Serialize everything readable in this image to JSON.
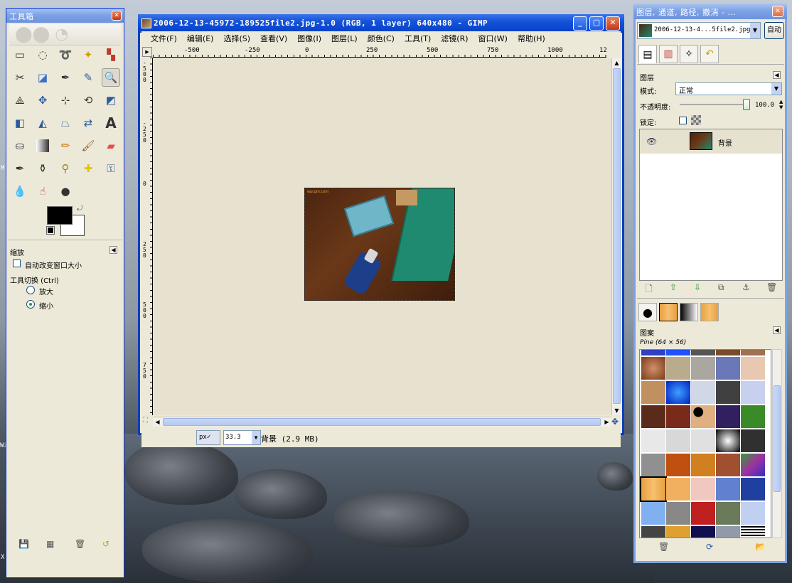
{
  "desktop_edge_texts": [
    "M",
    "Wi",
    "X"
  ],
  "toolbox": {
    "title": "工具箱",
    "close": "✕",
    "zoom_section": {
      "heading": "缩放",
      "auto_resize_label": "自动改变窗口大小",
      "switch_label": "工具切换 (Ctrl)",
      "zoom_in_label": "放大",
      "zoom_out_label": "缩小"
    }
  },
  "image_window": {
    "title": "2006-12-13-45972-189525file2.jpg-1.0 (RGB, 1 layer) 640x480 - GIMP",
    "menus": [
      "文件(F)",
      "编辑(E)",
      "选择(S)",
      "查看(V)",
      "图像(I)",
      "图层(L)",
      "颜色(C)",
      "工具(T)",
      "滤镜(R)",
      "窗口(W)",
      "帮助(H)"
    ],
    "ruler_h_labels": [
      "-500",
      "-250",
      "0",
      "250",
      "500",
      "750",
      "1000",
      "12"
    ],
    "ruler_v_labels": [
      "-500",
      "-250",
      "0",
      "250",
      "500",
      "750"
    ],
    "unit": "px",
    "zoom": "33.3",
    "status": "背景 (2.9 MB)",
    "photo_text": "wpcghr.com"
  },
  "layers_dock": {
    "title": "图层, 通道, 路径, 撤消 - ...",
    "image_select": "2006-12-13-4...5file2.jpg-1",
    "auto_button": "自动",
    "layers_heading": "图层",
    "mode_label": "模式:",
    "mode_value": "正常",
    "opacity_label": "不透明度:",
    "opacity_value": "100.0",
    "lock_label": "锁定:",
    "layer_name": "背景",
    "patterns_heading": "图案",
    "pattern_name": "Pine (64 × 56)"
  },
  "colors": {
    "titlebar_active": "#0a45cc",
    "window_bg": "#ece9d8",
    "canvas_bg": "#e6e2cf",
    "fg_color": "#000000",
    "bg_color": "#ffffff"
  }
}
